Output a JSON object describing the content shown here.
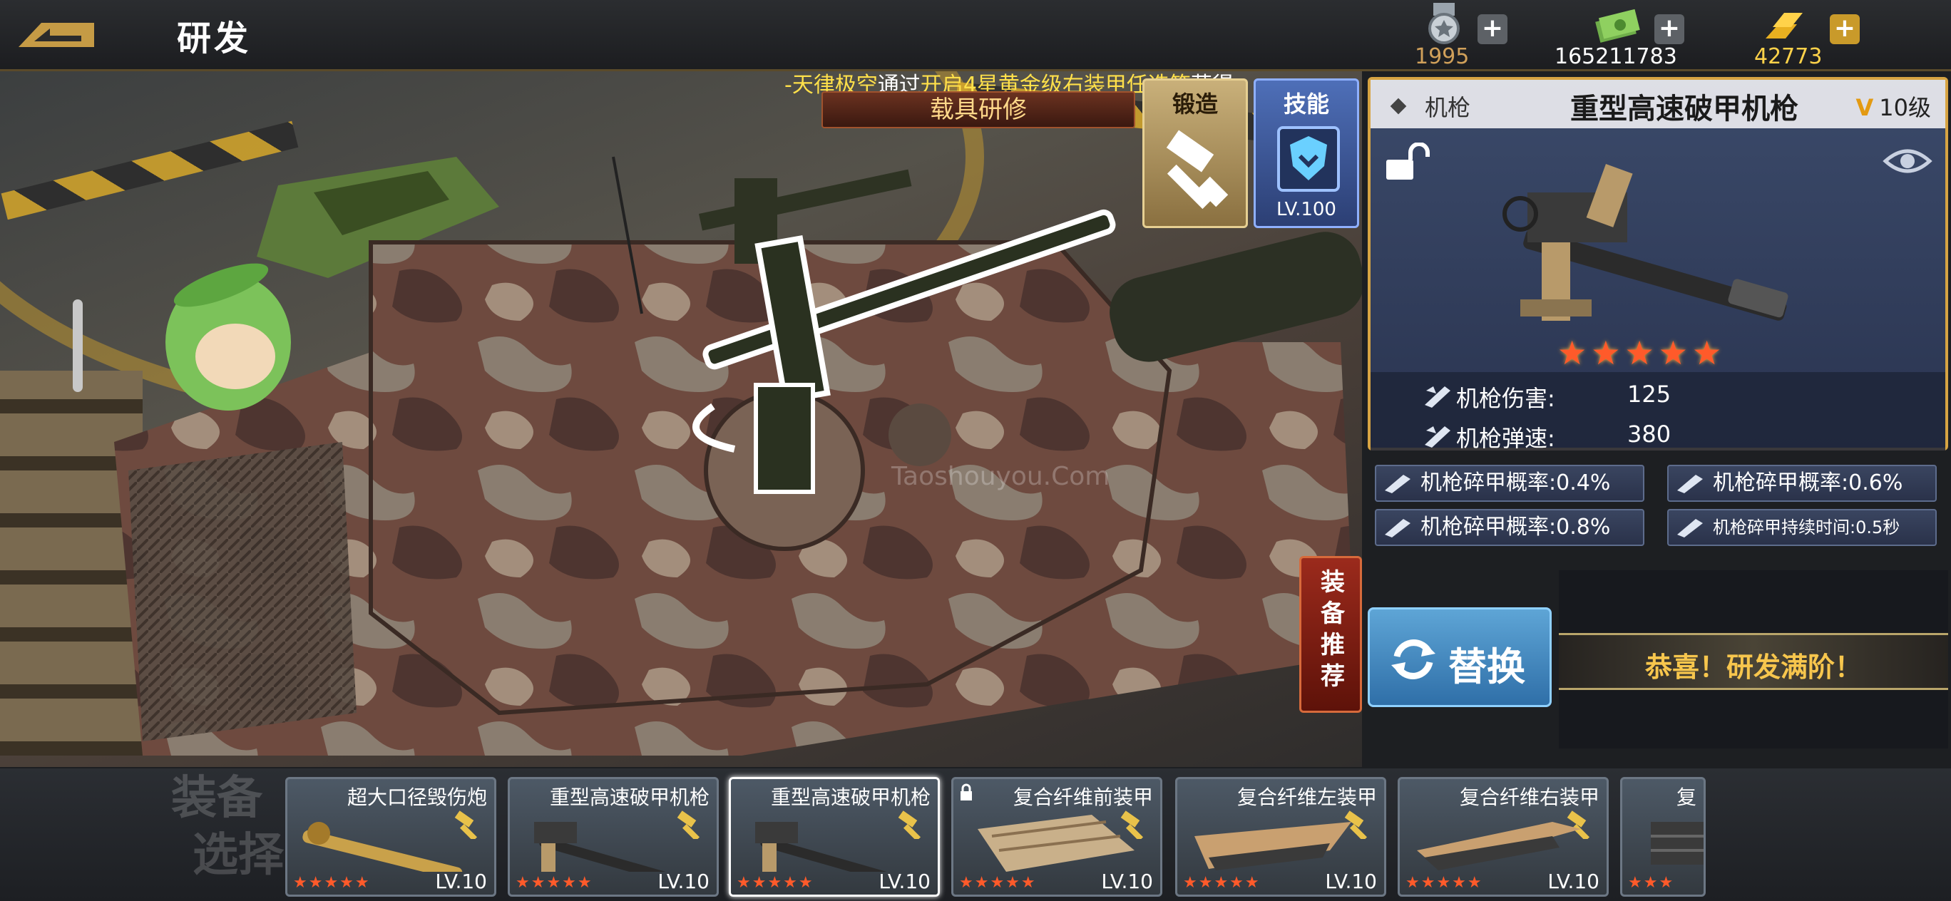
{
  "header": {
    "title": "研发",
    "currencies": [
      {
        "icon": "medal-icon",
        "value": "1995",
        "color": "#d0a05a"
      },
      {
        "icon": "cash-icon",
        "value": "165211783",
        "color": "#ffffff"
      },
      {
        "icon": "gold-bars-icon",
        "value": "42773",
        "color": "#ffd24a"
      }
    ],
    "plus_label": "+"
  },
  "marquee": {
    "part1": "-天律极空",
    "part2": "通过",
    "part3": "开启4星黄金级右装甲任选箱",
    "part4": "获得"
  },
  "tabs": {
    "vehicle_repair": "载具研修",
    "forge": "锻造",
    "skill": "技能",
    "skill_level": "LV.100"
  },
  "detail": {
    "type": "机枪",
    "name": "重型高速破甲机枪",
    "level_prefix": "V",
    "level": "10级",
    "stars": "★★★★★",
    "stats": [
      {
        "label": "机枪伤害:",
        "value": "125"
      },
      {
        "label": "机枪弹速:",
        "value": "380"
      }
    ],
    "sub_stats": [
      "机枪碎甲概率:0.4%",
      "机枪碎甲概率:0.6%",
      "机枪碎甲概率:0.8%",
      "机枪碎甲持续时间:0.5秒"
    ]
  },
  "actions": {
    "replace": "替换",
    "max_message": "恭喜！研发满阶！",
    "equip_recommend": "装备推荐"
  },
  "equip_select": {
    "label_line1": "装备",
    "label_line2": "选择",
    "cards": [
      {
        "name": "超大口径毁伤炮",
        "level": "LV.10",
        "stars": "★★★★★",
        "locked": false,
        "selected": false
      },
      {
        "name": "重型高速破甲机枪",
        "level": "LV.10",
        "stars": "★★★★★",
        "locked": false,
        "selected": false
      },
      {
        "name": "重型高速破甲机枪",
        "level": "LV.10",
        "stars": "★★★★★",
        "locked": false,
        "selected": true
      },
      {
        "name": "复合纤维前装甲",
        "level": "LV.10",
        "stars": "★★★★★",
        "locked": true,
        "selected": false
      },
      {
        "name": "复合纤维左装甲",
        "level": "LV.10",
        "stars": "★★★★★",
        "locked": false,
        "selected": false
      },
      {
        "name": "复合纤维右装甲",
        "level": "LV.10",
        "stars": "★★★★★",
        "locked": false,
        "selected": false
      },
      {
        "name": "复",
        "level": "",
        "stars": "★★★",
        "locked": false,
        "selected": false
      }
    ]
  },
  "watermark": "Taoshouyou.Com"
}
